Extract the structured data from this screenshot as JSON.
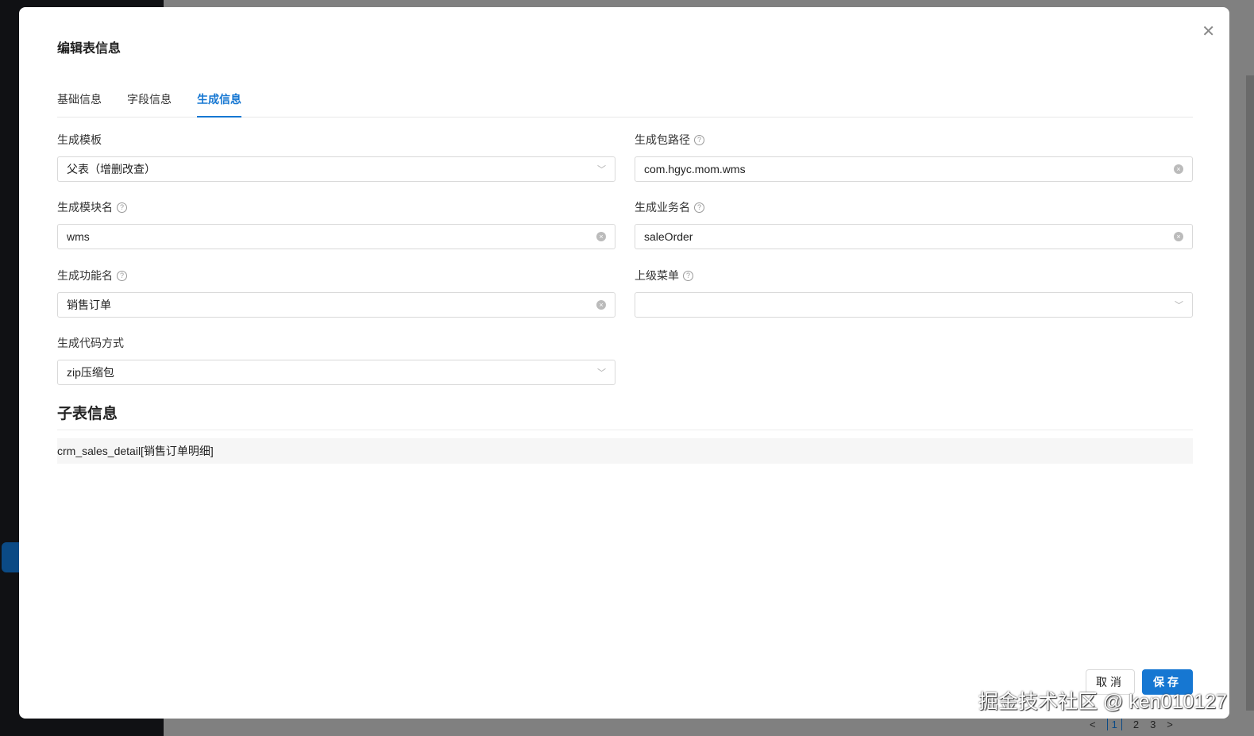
{
  "dialog": {
    "title": "编辑表信息"
  },
  "tabs": [
    "基础信息",
    "字段信息",
    "生成信息"
  ],
  "form": {
    "template": {
      "label": "生成模板",
      "value": "父表（增删改查）"
    },
    "package": {
      "label": "生成包路径",
      "value": "com.hgyc.mom.wms"
    },
    "module": {
      "label": "生成模块名",
      "value": "wms"
    },
    "business": {
      "label": "生成业务名",
      "value": "saleOrder"
    },
    "function": {
      "label": "生成功能名",
      "value": "销售订单"
    },
    "parent_menu": {
      "label": "上级菜单",
      "value": ""
    },
    "gen_type": {
      "label": "生成代码方式",
      "value": "zip压缩包"
    }
  },
  "subtable": {
    "title": "子表信息",
    "item": "crm_sales_detail[销售订单明细]"
  },
  "buttons": {
    "cancel": "取消",
    "save": "保存"
  },
  "pagination": {
    "prev": "<",
    "pages": [
      "1",
      "2",
      "3"
    ],
    "next": ">",
    "current": "1"
  },
  "watermark": "掘金技术社区 @ ken010127"
}
